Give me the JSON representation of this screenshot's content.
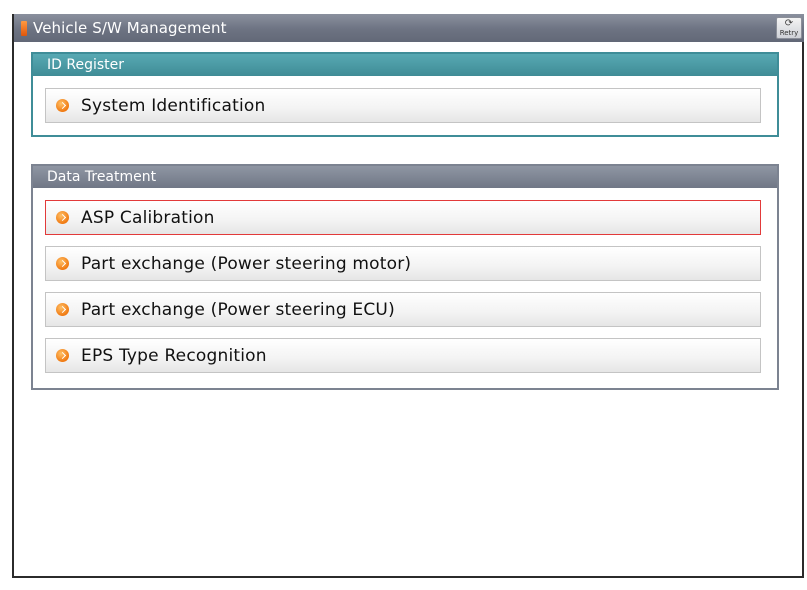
{
  "window": {
    "title": "Vehicle S/W Management",
    "retry_label": "Retry",
    "retry_icon": "refresh-icon"
  },
  "sections": [
    {
      "header": "ID Register",
      "items": [
        {
          "label": "System Identification",
          "icon": "orange-arrow-bullet-icon"
        }
      ]
    },
    {
      "header": "Data Treatment",
      "items": [
        {
          "label": "ASP Calibration",
          "icon": "orange-arrow-bullet-icon",
          "selected": true
        },
        {
          "label": "Part exchange (Power steering motor)",
          "icon": "orange-arrow-bullet-icon"
        },
        {
          "label": "Part exchange (Power steering ECU)",
          "icon": "orange-arrow-bullet-icon"
        },
        {
          "label": "EPS Type Recognition",
          "icon": "orange-arrow-bullet-icon"
        }
      ]
    }
  ],
  "colors": {
    "title_bar": "#6d7382",
    "id_register_accent": "#3f8d98",
    "data_treatment_accent": "#7c8391",
    "selection_border": "#e23a3a",
    "bullet": "#f07a12"
  }
}
